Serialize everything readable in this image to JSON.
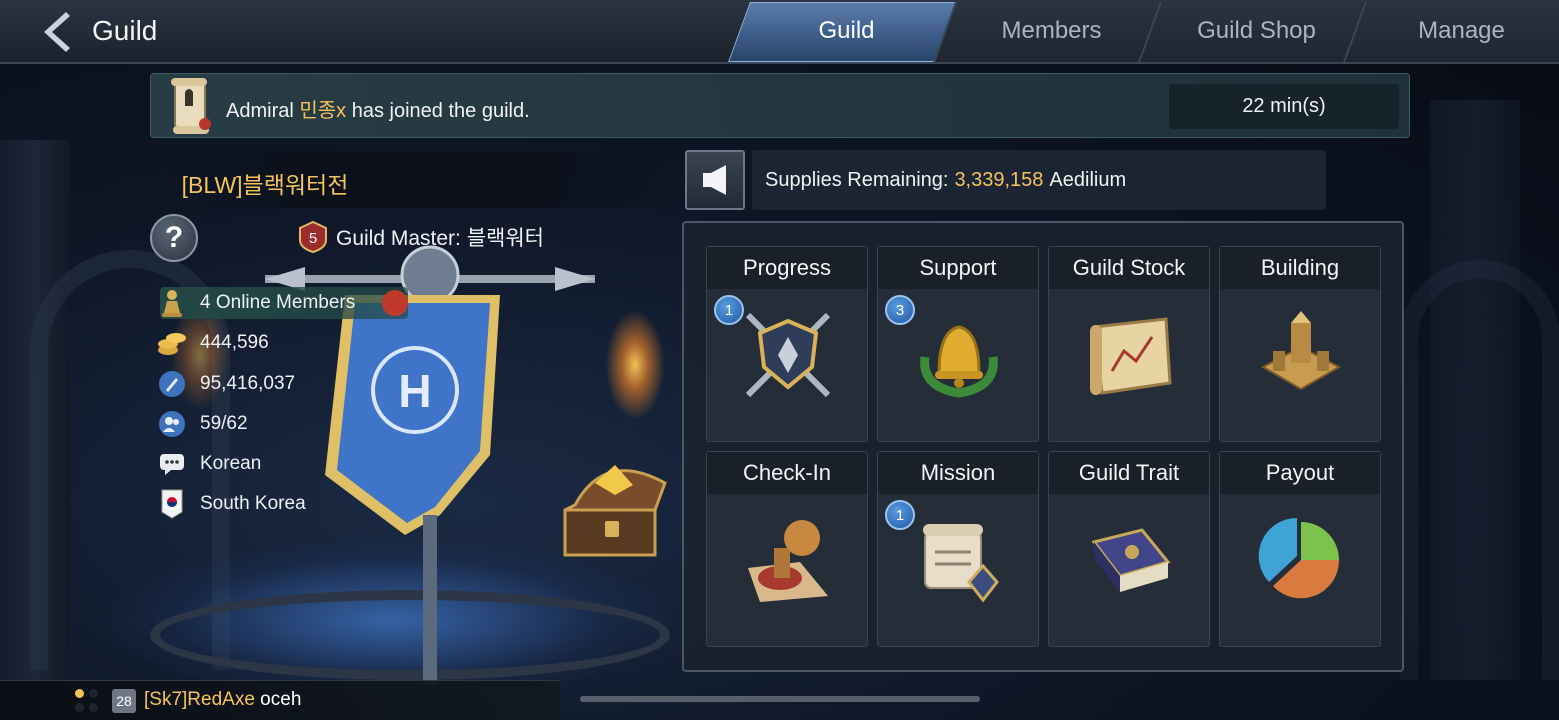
{
  "header": {
    "title": "Guild",
    "tabs": [
      {
        "label": "Guild",
        "active": true
      },
      {
        "label": "Members",
        "active": false
      },
      {
        "label": "Guild Shop",
        "active": false
      },
      {
        "label": "Manage",
        "active": false
      }
    ]
  },
  "notice": {
    "prefix": "Admiral ",
    "player": "민종x",
    "suffix": " has joined the guild.",
    "time": "22 min(s)"
  },
  "guild": {
    "name": "[BLW]블랙워터전",
    "master_label": "Guild Master: 블랙워터",
    "master_rank": "5",
    "online_members": "4 Online Members",
    "gold": "444,596",
    "power": "95,416,037",
    "members": "59/62",
    "language": "Korean",
    "region": "South Korea"
  },
  "supplies": {
    "label": "Supplies Remaining:",
    "value": "3,339,158",
    "unit": "Aedilium"
  },
  "features": [
    {
      "label": "Progress",
      "badge": "1",
      "icon": "crossed-swords-shield-icon"
    },
    {
      "label": "Support",
      "badge": "3",
      "icon": "bell-wreath-icon"
    },
    {
      "label": "Guild Stock",
      "badge": "",
      "icon": "map-scroll-icon"
    },
    {
      "label": "Building",
      "badge": "",
      "icon": "castle-building-icon"
    },
    {
      "label": "Check-In",
      "badge": "",
      "icon": "stamp-icon"
    },
    {
      "label": "Mission",
      "badge": "1",
      "icon": "mission-scroll-icon"
    },
    {
      "label": "Guild Trait",
      "badge": "",
      "icon": "book-icon"
    },
    {
      "label": "Payout",
      "badge": "",
      "icon": "pie-chart-icon"
    }
  ],
  "chat": {
    "level": "28",
    "name": "[Sk7]RedAxe",
    "message": " oceh"
  },
  "colors": {
    "accent_gold": "#f5c35a",
    "tab_active": "#3b5a86",
    "badge_blue": "#1f5aa3"
  }
}
